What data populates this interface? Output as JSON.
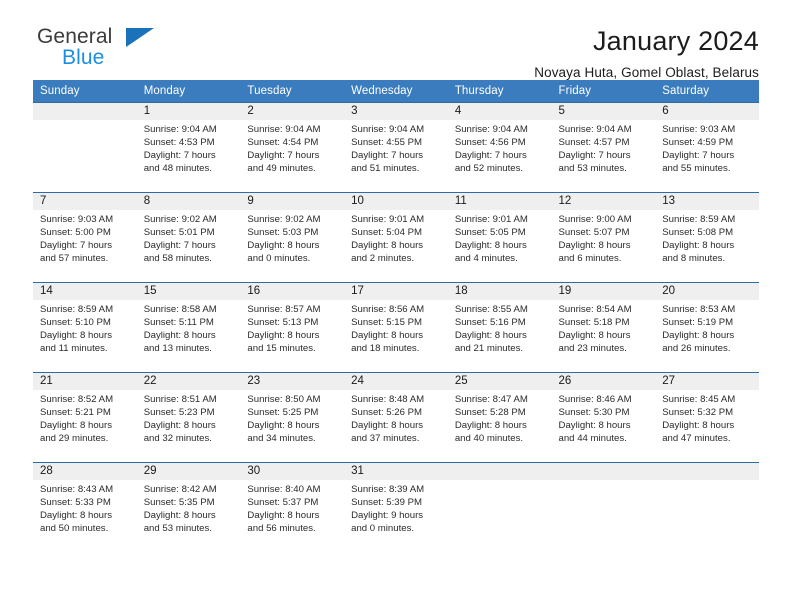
{
  "brand": {
    "name_part1": "General",
    "name_part2": "Blue",
    "colors": {
      "dark": "#3b3b3b",
      "blue": "#1a8fe0",
      "triangle": "#1a72bb"
    }
  },
  "header": {
    "title": "January 2024",
    "subtitle": "Novaya Huta, Gomel Oblast, Belarus"
  },
  "calendar": {
    "header_bg": "#3a7cbd",
    "daynum_bg": "#efefef",
    "weekdays": [
      "Sunday",
      "Monday",
      "Tuesday",
      "Wednesday",
      "Thursday",
      "Friday",
      "Saturday"
    ],
    "weeks": [
      [
        {
          "day": "",
          "sunrise": "",
          "sunset": "",
          "daylight_line1": "",
          "daylight_line2": "",
          "blank": true
        },
        {
          "day": "1",
          "sunrise": "Sunrise: 9:04 AM",
          "sunset": "Sunset: 4:53 PM",
          "daylight_line1": "Daylight: 7 hours",
          "daylight_line2": "and 48 minutes."
        },
        {
          "day": "2",
          "sunrise": "Sunrise: 9:04 AM",
          "sunset": "Sunset: 4:54 PM",
          "daylight_line1": "Daylight: 7 hours",
          "daylight_line2": "and 49 minutes."
        },
        {
          "day": "3",
          "sunrise": "Sunrise: 9:04 AM",
          "sunset": "Sunset: 4:55 PM",
          "daylight_line1": "Daylight: 7 hours",
          "daylight_line2": "and 51 minutes."
        },
        {
          "day": "4",
          "sunrise": "Sunrise: 9:04 AM",
          "sunset": "Sunset: 4:56 PM",
          "daylight_line1": "Daylight: 7 hours",
          "daylight_line2": "and 52 minutes."
        },
        {
          "day": "5",
          "sunrise": "Sunrise: 9:04 AM",
          "sunset": "Sunset: 4:57 PM",
          "daylight_line1": "Daylight: 7 hours",
          "daylight_line2": "and 53 minutes."
        },
        {
          "day": "6",
          "sunrise": "Sunrise: 9:03 AM",
          "sunset": "Sunset: 4:59 PM",
          "daylight_line1": "Daylight: 7 hours",
          "daylight_line2": "and 55 minutes."
        }
      ],
      [
        {
          "day": "7",
          "sunrise": "Sunrise: 9:03 AM",
          "sunset": "Sunset: 5:00 PM",
          "daylight_line1": "Daylight: 7 hours",
          "daylight_line2": "and 57 minutes."
        },
        {
          "day": "8",
          "sunrise": "Sunrise: 9:02 AM",
          "sunset": "Sunset: 5:01 PM",
          "daylight_line1": "Daylight: 7 hours",
          "daylight_line2": "and 58 minutes."
        },
        {
          "day": "9",
          "sunrise": "Sunrise: 9:02 AM",
          "sunset": "Sunset: 5:03 PM",
          "daylight_line1": "Daylight: 8 hours",
          "daylight_line2": "and 0 minutes."
        },
        {
          "day": "10",
          "sunrise": "Sunrise: 9:01 AM",
          "sunset": "Sunset: 5:04 PM",
          "daylight_line1": "Daylight: 8 hours",
          "daylight_line2": "and 2 minutes."
        },
        {
          "day": "11",
          "sunrise": "Sunrise: 9:01 AM",
          "sunset": "Sunset: 5:05 PM",
          "daylight_line1": "Daylight: 8 hours",
          "daylight_line2": "and 4 minutes."
        },
        {
          "day": "12",
          "sunrise": "Sunrise: 9:00 AM",
          "sunset": "Sunset: 5:07 PM",
          "daylight_line1": "Daylight: 8 hours",
          "daylight_line2": "and 6 minutes."
        },
        {
          "day": "13",
          "sunrise": "Sunrise: 8:59 AM",
          "sunset": "Sunset: 5:08 PM",
          "daylight_line1": "Daylight: 8 hours",
          "daylight_line2": "and 8 minutes."
        }
      ],
      [
        {
          "day": "14",
          "sunrise": "Sunrise: 8:59 AM",
          "sunset": "Sunset: 5:10 PM",
          "daylight_line1": "Daylight: 8 hours",
          "daylight_line2": "and 11 minutes."
        },
        {
          "day": "15",
          "sunrise": "Sunrise: 8:58 AM",
          "sunset": "Sunset: 5:11 PM",
          "daylight_line1": "Daylight: 8 hours",
          "daylight_line2": "and 13 minutes."
        },
        {
          "day": "16",
          "sunrise": "Sunrise: 8:57 AM",
          "sunset": "Sunset: 5:13 PM",
          "daylight_line1": "Daylight: 8 hours",
          "daylight_line2": "and 15 minutes."
        },
        {
          "day": "17",
          "sunrise": "Sunrise: 8:56 AM",
          "sunset": "Sunset: 5:15 PM",
          "daylight_line1": "Daylight: 8 hours",
          "daylight_line2": "and 18 minutes."
        },
        {
          "day": "18",
          "sunrise": "Sunrise: 8:55 AM",
          "sunset": "Sunset: 5:16 PM",
          "daylight_line1": "Daylight: 8 hours",
          "daylight_line2": "and 21 minutes."
        },
        {
          "day": "19",
          "sunrise": "Sunrise: 8:54 AM",
          "sunset": "Sunset: 5:18 PM",
          "daylight_line1": "Daylight: 8 hours",
          "daylight_line2": "and 23 minutes."
        },
        {
          "day": "20",
          "sunrise": "Sunrise: 8:53 AM",
          "sunset": "Sunset: 5:19 PM",
          "daylight_line1": "Daylight: 8 hours",
          "daylight_line2": "and 26 minutes."
        }
      ],
      [
        {
          "day": "21",
          "sunrise": "Sunrise: 8:52 AM",
          "sunset": "Sunset: 5:21 PM",
          "daylight_line1": "Daylight: 8 hours",
          "daylight_line2": "and 29 minutes."
        },
        {
          "day": "22",
          "sunrise": "Sunrise: 8:51 AM",
          "sunset": "Sunset: 5:23 PM",
          "daylight_line1": "Daylight: 8 hours",
          "daylight_line2": "and 32 minutes."
        },
        {
          "day": "23",
          "sunrise": "Sunrise: 8:50 AM",
          "sunset": "Sunset: 5:25 PM",
          "daylight_line1": "Daylight: 8 hours",
          "daylight_line2": "and 34 minutes."
        },
        {
          "day": "24",
          "sunrise": "Sunrise: 8:48 AM",
          "sunset": "Sunset: 5:26 PM",
          "daylight_line1": "Daylight: 8 hours",
          "daylight_line2": "and 37 minutes."
        },
        {
          "day": "25",
          "sunrise": "Sunrise: 8:47 AM",
          "sunset": "Sunset: 5:28 PM",
          "daylight_line1": "Daylight: 8 hours",
          "daylight_line2": "and 40 minutes."
        },
        {
          "day": "26",
          "sunrise": "Sunrise: 8:46 AM",
          "sunset": "Sunset: 5:30 PM",
          "daylight_line1": "Daylight: 8 hours",
          "daylight_line2": "and 44 minutes."
        },
        {
          "day": "27",
          "sunrise": "Sunrise: 8:45 AM",
          "sunset": "Sunset: 5:32 PM",
          "daylight_line1": "Daylight: 8 hours",
          "daylight_line2": "and 47 minutes."
        }
      ],
      [
        {
          "day": "28",
          "sunrise": "Sunrise: 8:43 AM",
          "sunset": "Sunset: 5:33 PM",
          "daylight_line1": "Daylight: 8 hours",
          "daylight_line2": "and 50 minutes."
        },
        {
          "day": "29",
          "sunrise": "Sunrise: 8:42 AM",
          "sunset": "Sunset: 5:35 PM",
          "daylight_line1": "Daylight: 8 hours",
          "daylight_line2": "and 53 minutes."
        },
        {
          "day": "30",
          "sunrise": "Sunrise: 8:40 AM",
          "sunset": "Sunset: 5:37 PM",
          "daylight_line1": "Daylight: 8 hours",
          "daylight_line2": "and 56 minutes."
        },
        {
          "day": "31",
          "sunrise": "Sunrise: 8:39 AM",
          "sunset": "Sunset: 5:39 PM",
          "daylight_line1": "Daylight: 9 hours",
          "daylight_line2": "and 0 minutes."
        },
        {
          "day": "",
          "sunrise": "",
          "sunset": "",
          "daylight_line1": "",
          "daylight_line2": "",
          "blank": true
        },
        {
          "day": "",
          "sunrise": "",
          "sunset": "",
          "daylight_line1": "",
          "daylight_line2": "",
          "blank": true
        },
        {
          "day": "",
          "sunrise": "",
          "sunset": "",
          "daylight_line1": "",
          "daylight_line2": "",
          "blank": true
        }
      ]
    ]
  }
}
